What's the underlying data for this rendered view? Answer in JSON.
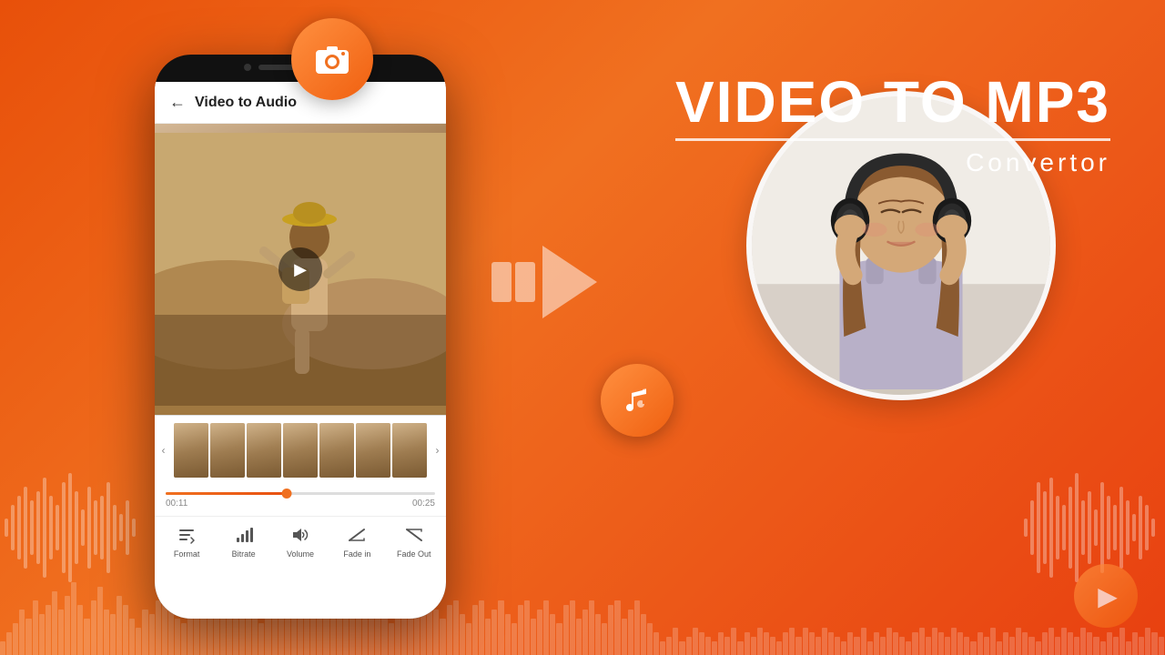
{
  "background": {
    "gradient_start": "#e85010",
    "gradient_end": "#f07020"
  },
  "title": {
    "main": "VIDEO TO MP3",
    "subtitle": "Convertor",
    "divider_visible": true
  },
  "phone": {
    "app_header": {
      "back_label": "←",
      "title": "Video to Audio"
    },
    "timeline": {
      "start_time": "00:11",
      "end_time": "00:25",
      "progress_percent": 45
    },
    "toolbar": {
      "items": [
        {
          "id": "format",
          "label": "Format",
          "icon": "♪"
        },
        {
          "id": "bitrate",
          "label": "Bitrate",
          "icon": "📊"
        },
        {
          "id": "volume",
          "label": "Volume",
          "icon": "🔊"
        },
        {
          "id": "fadein",
          "label": "Fade in",
          "icon": "📈"
        },
        {
          "id": "fadeout",
          "label": "Fade Out",
          "icon": "📉"
        }
      ]
    }
  },
  "icons": {
    "camera": "🎬",
    "music": "♪",
    "play": "▶"
  },
  "filmstrip": {
    "frame_count": 7,
    "left_arrow": "‹",
    "right_arrow": "›"
  }
}
